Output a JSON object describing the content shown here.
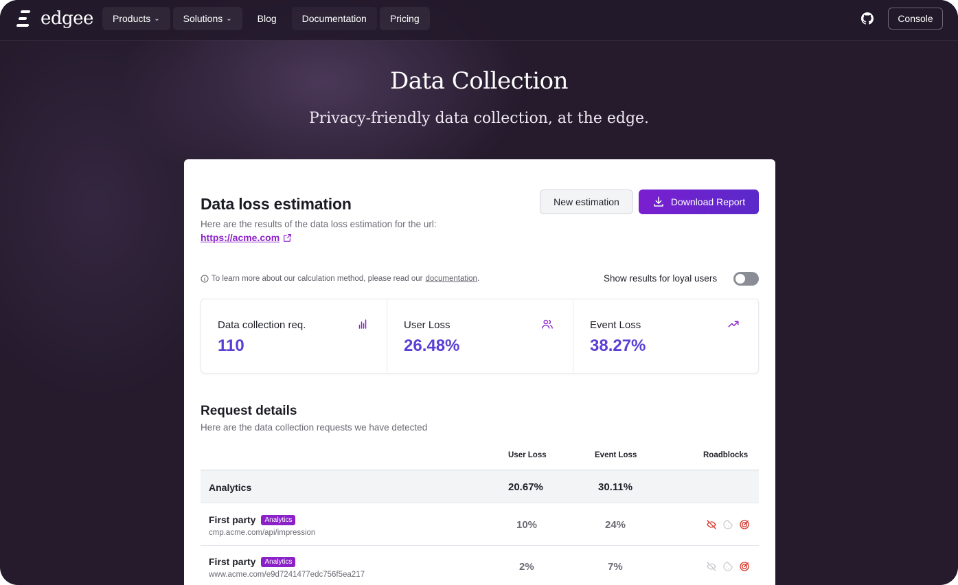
{
  "nav": {
    "logo_text": "edgee",
    "items": [
      {
        "label": "Products",
        "has_menu": true
      },
      {
        "label": "Solutions",
        "has_menu": true
      },
      {
        "label": "Blog",
        "has_menu": false
      },
      {
        "label": "Documentation",
        "has_menu": false
      },
      {
        "label": "Pricing",
        "has_menu": false
      }
    ],
    "github_icon": "github-icon",
    "console_label": "Console"
  },
  "hero": {
    "title": "Data Collection",
    "subtitle": "Privacy-friendly data collection, at the edge."
  },
  "estimation": {
    "title": "Data loss estimation",
    "description": "Here are the results of the data loss estimation for the url:",
    "url": "https://acme.com",
    "new_button": "New estimation",
    "download_button": "Download Report",
    "info_prefix": "To learn more about our calculation method, please read our",
    "info_link": "documentation",
    "info_suffix": ".",
    "toggle_label": "Show results for loyal users",
    "toggle_on": false
  },
  "stats": [
    {
      "label": "Data collection req.",
      "value": "110",
      "icon": "bar-chart-icon"
    },
    {
      "label": "User Loss",
      "value": "26.48%",
      "icon": "users-icon"
    },
    {
      "label": "Event Loss",
      "value": "38.27%",
      "icon": "trending-up-icon"
    }
  ],
  "requests": {
    "title": "Request details",
    "subtitle": "Here are the data collection requests we have detected",
    "columns": {
      "user_loss": "User Loss",
      "event_loss": "Event Loss",
      "roadblocks": "Roadblocks"
    },
    "group": {
      "name": "Analytics",
      "user_loss": "20.67%",
      "event_loss": "30.11%"
    },
    "rows": [
      {
        "name": "First party",
        "badge": "Analytics",
        "url": "cmp.acme.com/api/impression",
        "user_loss": "10%",
        "event_loss": "24%",
        "roadblocks": [
          "eye-off-icon",
          "cookie-icon",
          "target-icon"
        ]
      },
      {
        "name": "First party",
        "badge": "Analytics",
        "url": "www.acme.com/e9d7241477edc756f5ea217",
        "user_loss": "2%",
        "event_loss": "7%",
        "roadblocks": [
          "eye-off-icon",
          "cookie-icon",
          "target-icon"
        ]
      }
    ]
  },
  "colors": {
    "accent": "#8b22c8",
    "value": "#5a3fd4",
    "roadblock_active": "#d8352a",
    "roadblock_inactive": "#c8c9ce"
  }
}
